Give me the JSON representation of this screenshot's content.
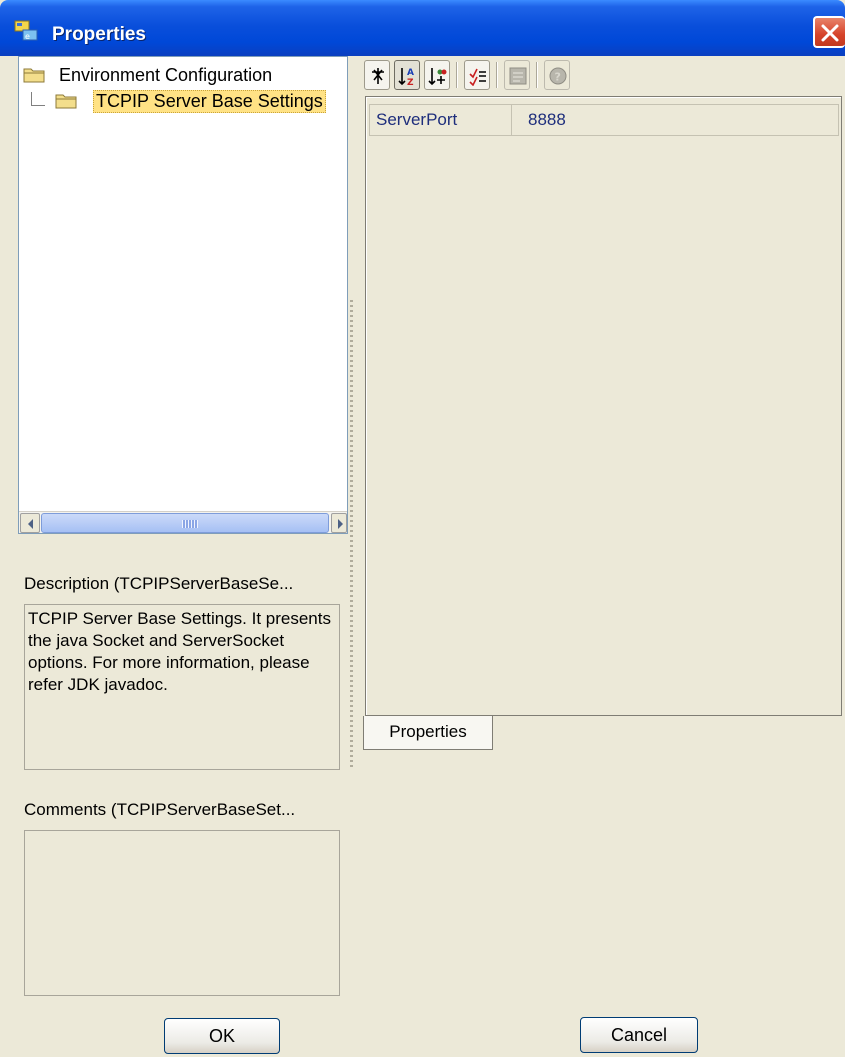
{
  "window": {
    "title": "Properties",
    "icon": "properties-app-icon",
    "close_icon": "close-icon"
  },
  "tree": {
    "root_label": "Environment Configuration",
    "child_label": "TCPIP Server Base Settings"
  },
  "description": {
    "label": "Description (TCPIPServerBaseSe...",
    "text": "TCPIP Server Base Settings. It presents the java Socket and ServerSocket options. For more information, please refer JDK javadoc."
  },
  "comments": {
    "label": "Comments (TCPIPServerBaseSet...",
    "text": ""
  },
  "toolbar": {
    "buttons": [
      "sort-unsorted-icon",
      "sort-alphabetical-icon",
      "sort-by-category-icon",
      "show-descriptions-icon",
      "property-pages-icon",
      "help-icon"
    ]
  },
  "properties": {
    "rows": [
      {
        "name": "ServerPort",
        "value": "8888"
      }
    ]
  },
  "tabs": {
    "properties_tab": "Properties"
  },
  "buttons": {
    "ok": "OK",
    "cancel": "Cancel"
  },
  "colors": {
    "titlebar": "#0A4FDB",
    "selection": "#FFE285",
    "property_text": "#1E2E7C",
    "dialog_bg": "#ECE9D8"
  }
}
